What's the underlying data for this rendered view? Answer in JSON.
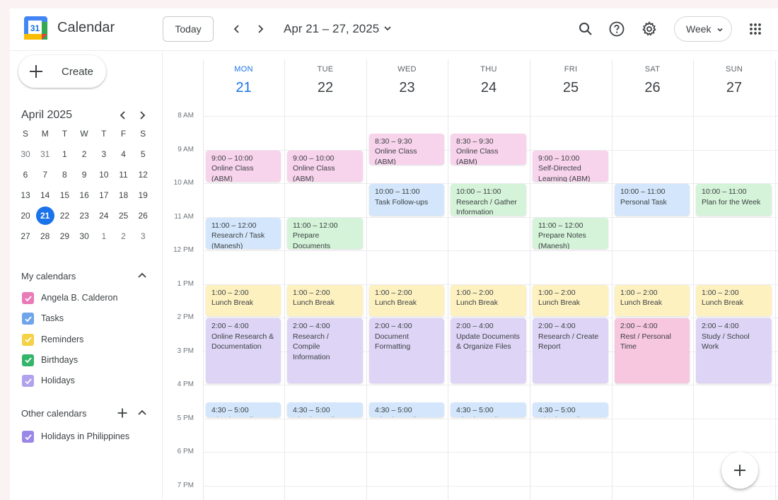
{
  "header": {
    "app_title": "Calendar",
    "logo_text": "31",
    "today_label": "Today",
    "date_range": "Apr 21 – 27, 2025",
    "view_label": "Week",
    "icons": [
      "calendar-logo",
      "chevron-left-icon",
      "chevron-right-icon",
      "chevron-down-icon",
      "search-icon",
      "help-icon",
      "settings-icon",
      "apps-grid-icon"
    ]
  },
  "sidebar": {
    "create_label": "Create",
    "mini_calendar": {
      "title": "April 2025",
      "weekdays": [
        "S",
        "M",
        "T",
        "W",
        "T",
        "F",
        "S"
      ],
      "weeks": [
        [
          "30",
          "31",
          "1",
          "2",
          "3",
          "4",
          "5"
        ],
        [
          "6",
          "7",
          "8",
          "9",
          "10",
          "11",
          "12"
        ],
        [
          "13",
          "14",
          "15",
          "16",
          "17",
          "18",
          "19"
        ],
        [
          "20",
          "21",
          "22",
          "23",
          "24",
          "25",
          "26"
        ],
        [
          "27",
          "28",
          "29",
          "30",
          "1",
          "2",
          "3"
        ]
      ],
      "dim_cells": [
        [
          0,
          0
        ],
        [
          0,
          1
        ],
        [
          4,
          4
        ],
        [
          4,
          5
        ],
        [
          4,
          6
        ]
      ],
      "today": "21"
    },
    "my_calendars": {
      "title": "My calendars",
      "items": [
        {
          "name": "Angela B. Calderon",
          "color": "#e87bb8"
        },
        {
          "name": "Tasks",
          "color": "#6ea5ea"
        },
        {
          "name": "Reminders",
          "color": "#f5d145"
        },
        {
          "name": "Birthdays",
          "color": "#34b56a"
        },
        {
          "name": "Holidays",
          "color": "#b1a2ee"
        }
      ]
    },
    "other_calendars": {
      "title": "Other calendars",
      "items": [
        {
          "name": "Holidays in Philippines",
          "color": "#9b87e8"
        }
      ]
    }
  },
  "week": {
    "days": [
      {
        "dow": "MON",
        "num": "21",
        "current": true
      },
      {
        "dow": "TUE",
        "num": "22"
      },
      {
        "dow": "WED",
        "num": "23"
      },
      {
        "dow": "THU",
        "num": "24"
      },
      {
        "dow": "FRI",
        "num": "25"
      },
      {
        "dow": "SAT",
        "num": "26"
      },
      {
        "dow": "SUN",
        "num": "27"
      }
    ],
    "hours": [
      "8 AM",
      "9 AM",
      "10 AM",
      "11 AM",
      "12 PM",
      "1 PM",
      "2 PM",
      "3 PM",
      "4 PM",
      "5 PM",
      "6 PM",
      "7 PM"
    ],
    "events": [
      {
        "day": 0,
        "start": 9,
        "end": 10,
        "time": "9:00 – 10:00",
        "title": "Online Class (ABM)",
        "color": "pink"
      },
      {
        "day": 0,
        "start": 11,
        "end": 12,
        "time": "11:00 – 12:00",
        "title": "Research / Task (Manesh)",
        "color": "blue"
      },
      {
        "day": 0,
        "start": 13,
        "end": 14,
        "time": "1:00 – 2:00",
        "title": "Lunch Break",
        "color": "yellow"
      },
      {
        "day": 0,
        "start": 14,
        "end": 16,
        "time": "2:00 – 4:00",
        "title": "Online Research & Documentation",
        "color": "purple"
      },
      {
        "day": 0,
        "start": 16.5,
        "end": 17,
        "time": "4:30 – 5:00",
        "title": "Check Emails",
        "color": "blue"
      },
      {
        "day": 1,
        "start": 9,
        "end": 10,
        "time": "9:00 – 10:00",
        "title": "Online Class (ABM)",
        "color": "pink"
      },
      {
        "day": 1,
        "start": 11,
        "end": 12,
        "time": "11:00 – 12:00",
        "title": "Prepare Documents (Manesh)",
        "color": "green"
      },
      {
        "day": 1,
        "start": 13,
        "end": 14,
        "time": "1:00 – 2:00",
        "title": "Lunch Break",
        "color": "yellow"
      },
      {
        "day": 1,
        "start": 14,
        "end": 16,
        "time": "2:00 – 4:00",
        "title": "Research / Compile Information",
        "color": "purple"
      },
      {
        "day": 1,
        "start": 16.5,
        "end": 17,
        "time": "4:30 – 5:00",
        "title": "Check Emails",
        "color": "blue"
      },
      {
        "day": 2,
        "start": 8.5,
        "end": 9.5,
        "time": "8:30 – 9:30",
        "title": "Online Class (ABM)",
        "color": "pink"
      },
      {
        "day": 2,
        "start": 10,
        "end": 11,
        "time": "10:00 – 11:00",
        "title": "Task Follow-ups",
        "color": "blue"
      },
      {
        "day": 2,
        "start": 13,
        "end": 14,
        "time": "1:00 – 2:00",
        "title": "Lunch Break",
        "color": "yellow"
      },
      {
        "day": 2,
        "start": 14,
        "end": 16,
        "time": "2:00 – 4:00",
        "title": "Document Formatting",
        "color": "purple"
      },
      {
        "day": 2,
        "start": 16.5,
        "end": 17,
        "time": "4:30 – 5:00",
        "title": "Check Emails",
        "color": "blue"
      },
      {
        "day": 3,
        "start": 8.5,
        "end": 9.5,
        "time": "8:30 – 9:30",
        "title": "Online Class (ABM)",
        "color": "pink"
      },
      {
        "day": 3,
        "start": 10,
        "end": 11,
        "time": "10:00 – 11:00",
        "title": "Research / Gather Information",
        "color": "green"
      },
      {
        "day": 3,
        "start": 13,
        "end": 14,
        "time": "1:00 – 2:00",
        "title": "Lunch Break",
        "color": "yellow"
      },
      {
        "day": 3,
        "start": 14,
        "end": 16,
        "time": "2:00 – 4:00",
        "title": "Update Documents & Organize Files",
        "color": "purple"
      },
      {
        "day": 3,
        "start": 16.5,
        "end": 17,
        "time": "4:30 – 5:00",
        "title": "Check Emails",
        "color": "blue"
      },
      {
        "day": 4,
        "start": 9,
        "end": 10,
        "time": "9:00 – 10:00",
        "title": "Self-Directed Learning (ABM)",
        "color": "pink"
      },
      {
        "day": 4,
        "start": 11,
        "end": 12,
        "time": "11:00 – 12:00",
        "title": "Prepare Notes (Manesh)",
        "color": "green"
      },
      {
        "day": 4,
        "start": 13,
        "end": 14,
        "time": "1:00 – 2:00",
        "title": "Lunch Break",
        "color": "yellow"
      },
      {
        "day": 4,
        "start": 14,
        "end": 16,
        "time": "2:00 – 4:00",
        "title": "Research / Create Report",
        "color": "purple"
      },
      {
        "day": 4,
        "start": 16.5,
        "end": 17,
        "time": "4:30 – 5:00",
        "title": "Check Emails",
        "color": "blue"
      },
      {
        "day": 5,
        "start": 10,
        "end": 11,
        "time": "10:00 – 11:00",
        "title": "Personal Task",
        "color": "blue"
      },
      {
        "day": 5,
        "start": 13,
        "end": 14,
        "time": "1:00 – 2:00",
        "title": "Lunch Break",
        "color": "yellow"
      },
      {
        "day": 5,
        "start": 14,
        "end": 16,
        "time": "2:00 – 4:00",
        "title": "Rest / Personal Time",
        "color": "rose"
      },
      {
        "day": 6,
        "start": 10,
        "end": 11,
        "time": "10:00 – 11:00",
        "title": "Plan for the Week",
        "color": "green"
      },
      {
        "day": 6,
        "start": 13,
        "end": 14,
        "time": "1:00 – 2:00",
        "title": "Lunch Break",
        "color": "yellow"
      },
      {
        "day": 6,
        "start": 14,
        "end": 16,
        "time": "2:00 – 4:00",
        "title": "Study / School Work",
        "color": "purple"
      }
    ]
  },
  "colors": {
    "accent": "#1a73e8",
    "pink": "#f8d3ec",
    "blue": "#d3e6fb",
    "green": "#d4f3d8",
    "yellow": "#fdf1c0",
    "purple": "#ddd4f6",
    "rose": "#f7c6df"
  }
}
